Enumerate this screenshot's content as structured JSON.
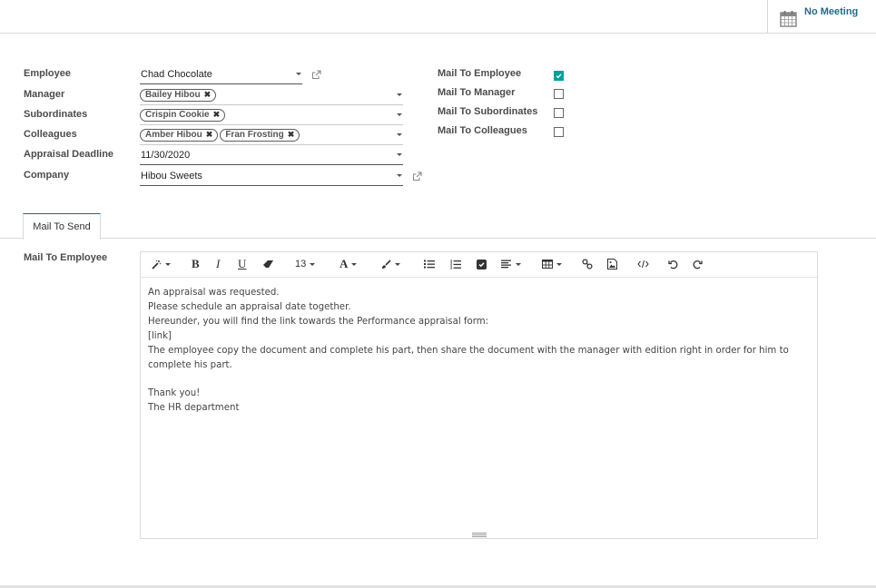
{
  "topbar": {
    "smart_button": {
      "label": "No Meeting",
      "icon": "calendar-icon"
    }
  },
  "form": {
    "employee": {
      "label": "Employee",
      "value": "Chad Chocolate"
    },
    "manager": {
      "label": "Manager",
      "tags": [
        "Bailey Hibou"
      ]
    },
    "subordinates": {
      "label": "Subordinates",
      "tags": [
        "Crispin Cookie"
      ]
    },
    "colleagues": {
      "label": "Colleagues",
      "tags": [
        "Amber Hibou",
        "Fran Frosting"
      ]
    },
    "deadline": {
      "label": "Appraisal Deadline",
      "value": "11/30/2020"
    },
    "company": {
      "label": "Company",
      "value": "Hibou Sweets"
    },
    "mail_to_employee": {
      "label": "Mail To Employee",
      "checked": true
    },
    "mail_to_manager": {
      "label": "Mail To Manager",
      "checked": false
    },
    "mail_to_subordinates": {
      "label": "Mail To Subordinates",
      "checked": false
    },
    "mail_to_colleagues": {
      "label": "Mail To Colleagues",
      "checked": false
    }
  },
  "tabs": [
    {
      "label": "Mail To Send",
      "active": true
    }
  ],
  "editor": {
    "field_label": "Mail To Employee",
    "font_size": "13",
    "toolbar_icons": [
      "magic-wand-icon",
      "bold-icon",
      "italic-icon",
      "underline-icon",
      "eraser-icon",
      "font-size-dropdown",
      "font-color-icon",
      "paint-brush-icon",
      "bullet-list-icon",
      "numbered-list-icon",
      "checklist-icon",
      "align-icon",
      "table-icon",
      "link-icon",
      "image-icon",
      "code-view-icon",
      "undo-icon",
      "redo-icon"
    ],
    "bold_glyph": "B",
    "italic_glyph": "I",
    "underline_glyph": "U",
    "font_color_glyph": "A",
    "lines": [
      "An appraisal was requested.",
      "Please schedule an appraisal date together.",
      "Hereunder, you will find the link towards the Performance appraisal form:",
      "[link]",
      "The employee copy the document and complete his part, then share the document with the manager with edition right in order for him to complete his part.",
      "",
      "Thank you!",
      "The HR department"
    ]
  },
  "colors": {
    "accent": "#00a09d",
    "link": "#1f6a8c"
  }
}
